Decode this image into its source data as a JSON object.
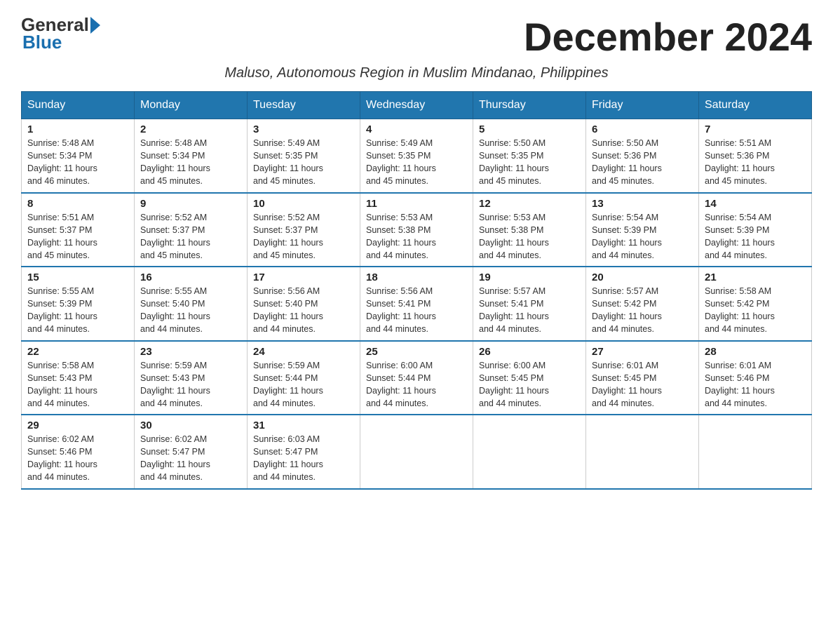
{
  "logo": {
    "general": "General",
    "blue": "Blue"
  },
  "title": "December 2024",
  "subtitle": "Maluso, Autonomous Region in Muslim Mindanao, Philippines",
  "days_of_week": [
    "Sunday",
    "Monday",
    "Tuesday",
    "Wednesday",
    "Thursday",
    "Friday",
    "Saturday"
  ],
  "weeks": [
    [
      {
        "day": "1",
        "sunrise": "5:48 AM",
        "sunset": "5:34 PM",
        "daylight": "11 hours and 46 minutes."
      },
      {
        "day": "2",
        "sunrise": "5:48 AM",
        "sunset": "5:34 PM",
        "daylight": "11 hours and 45 minutes."
      },
      {
        "day": "3",
        "sunrise": "5:49 AM",
        "sunset": "5:35 PM",
        "daylight": "11 hours and 45 minutes."
      },
      {
        "day": "4",
        "sunrise": "5:49 AM",
        "sunset": "5:35 PM",
        "daylight": "11 hours and 45 minutes."
      },
      {
        "day": "5",
        "sunrise": "5:50 AM",
        "sunset": "5:35 PM",
        "daylight": "11 hours and 45 minutes."
      },
      {
        "day": "6",
        "sunrise": "5:50 AM",
        "sunset": "5:36 PM",
        "daylight": "11 hours and 45 minutes."
      },
      {
        "day": "7",
        "sunrise": "5:51 AM",
        "sunset": "5:36 PM",
        "daylight": "11 hours and 45 minutes."
      }
    ],
    [
      {
        "day": "8",
        "sunrise": "5:51 AM",
        "sunset": "5:37 PM",
        "daylight": "11 hours and 45 minutes."
      },
      {
        "day": "9",
        "sunrise": "5:52 AM",
        "sunset": "5:37 PM",
        "daylight": "11 hours and 45 minutes."
      },
      {
        "day": "10",
        "sunrise": "5:52 AM",
        "sunset": "5:37 PM",
        "daylight": "11 hours and 45 minutes."
      },
      {
        "day": "11",
        "sunrise": "5:53 AM",
        "sunset": "5:38 PM",
        "daylight": "11 hours and 44 minutes."
      },
      {
        "day": "12",
        "sunrise": "5:53 AM",
        "sunset": "5:38 PM",
        "daylight": "11 hours and 44 minutes."
      },
      {
        "day": "13",
        "sunrise": "5:54 AM",
        "sunset": "5:39 PM",
        "daylight": "11 hours and 44 minutes."
      },
      {
        "day": "14",
        "sunrise": "5:54 AM",
        "sunset": "5:39 PM",
        "daylight": "11 hours and 44 minutes."
      }
    ],
    [
      {
        "day": "15",
        "sunrise": "5:55 AM",
        "sunset": "5:39 PM",
        "daylight": "11 hours and 44 minutes."
      },
      {
        "day": "16",
        "sunrise": "5:55 AM",
        "sunset": "5:40 PM",
        "daylight": "11 hours and 44 minutes."
      },
      {
        "day": "17",
        "sunrise": "5:56 AM",
        "sunset": "5:40 PM",
        "daylight": "11 hours and 44 minutes."
      },
      {
        "day": "18",
        "sunrise": "5:56 AM",
        "sunset": "5:41 PM",
        "daylight": "11 hours and 44 minutes."
      },
      {
        "day": "19",
        "sunrise": "5:57 AM",
        "sunset": "5:41 PM",
        "daylight": "11 hours and 44 minutes."
      },
      {
        "day": "20",
        "sunrise": "5:57 AM",
        "sunset": "5:42 PM",
        "daylight": "11 hours and 44 minutes."
      },
      {
        "day": "21",
        "sunrise": "5:58 AM",
        "sunset": "5:42 PM",
        "daylight": "11 hours and 44 minutes."
      }
    ],
    [
      {
        "day": "22",
        "sunrise": "5:58 AM",
        "sunset": "5:43 PM",
        "daylight": "11 hours and 44 minutes."
      },
      {
        "day": "23",
        "sunrise": "5:59 AM",
        "sunset": "5:43 PM",
        "daylight": "11 hours and 44 minutes."
      },
      {
        "day": "24",
        "sunrise": "5:59 AM",
        "sunset": "5:44 PM",
        "daylight": "11 hours and 44 minutes."
      },
      {
        "day": "25",
        "sunrise": "6:00 AM",
        "sunset": "5:44 PM",
        "daylight": "11 hours and 44 minutes."
      },
      {
        "day": "26",
        "sunrise": "6:00 AM",
        "sunset": "5:45 PM",
        "daylight": "11 hours and 44 minutes."
      },
      {
        "day": "27",
        "sunrise": "6:01 AM",
        "sunset": "5:45 PM",
        "daylight": "11 hours and 44 minutes."
      },
      {
        "day": "28",
        "sunrise": "6:01 AM",
        "sunset": "5:46 PM",
        "daylight": "11 hours and 44 minutes."
      }
    ],
    [
      {
        "day": "29",
        "sunrise": "6:02 AM",
        "sunset": "5:46 PM",
        "daylight": "11 hours and 44 minutes."
      },
      {
        "day": "30",
        "sunrise": "6:02 AM",
        "sunset": "5:47 PM",
        "daylight": "11 hours and 44 minutes."
      },
      {
        "day": "31",
        "sunrise": "6:03 AM",
        "sunset": "5:47 PM",
        "daylight": "11 hours and 44 minutes."
      },
      null,
      null,
      null,
      null
    ]
  ],
  "labels": {
    "sunrise": "Sunrise:",
    "sunset": "Sunset:",
    "daylight": "Daylight:"
  }
}
